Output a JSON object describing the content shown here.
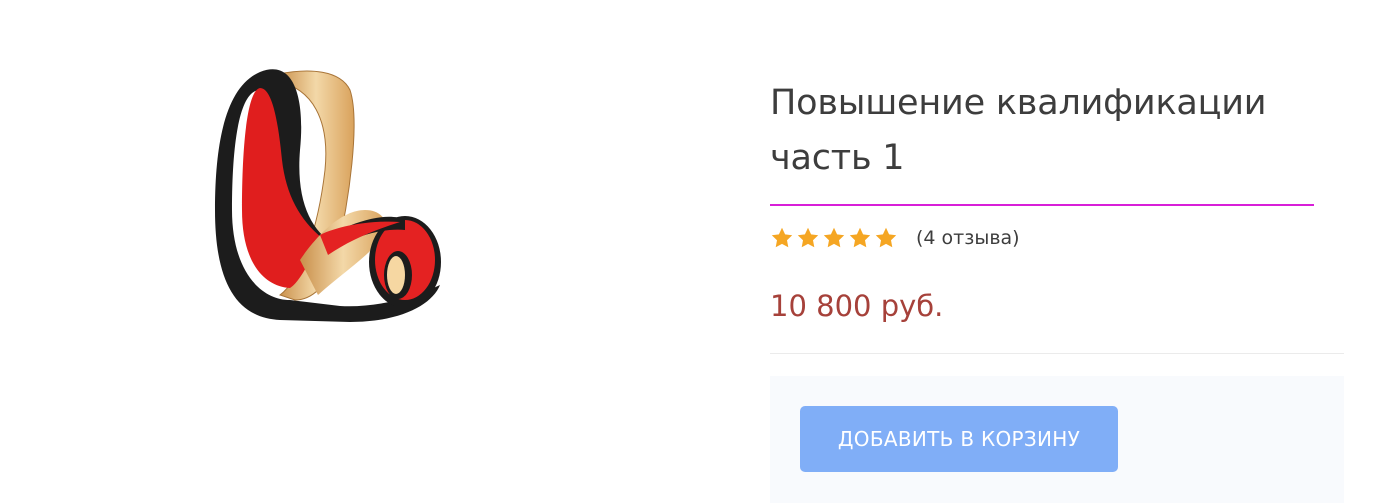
{
  "product": {
    "image_icon": "ribbon-chair-logo-icon",
    "title": "Повышение квалификации часть 1",
    "rating": {
      "value": 5,
      "max": 5
    },
    "reviews_text": "(4 отзыва)",
    "price": "10 800 руб.",
    "add_to_cart_label": "ДОБАВИТЬ В КОРЗИНУ"
  },
  "colors": {
    "title_rule": "#d81fd8",
    "star": "#f5a623",
    "price": "#a6413a",
    "button_bg": "#80aef7"
  }
}
